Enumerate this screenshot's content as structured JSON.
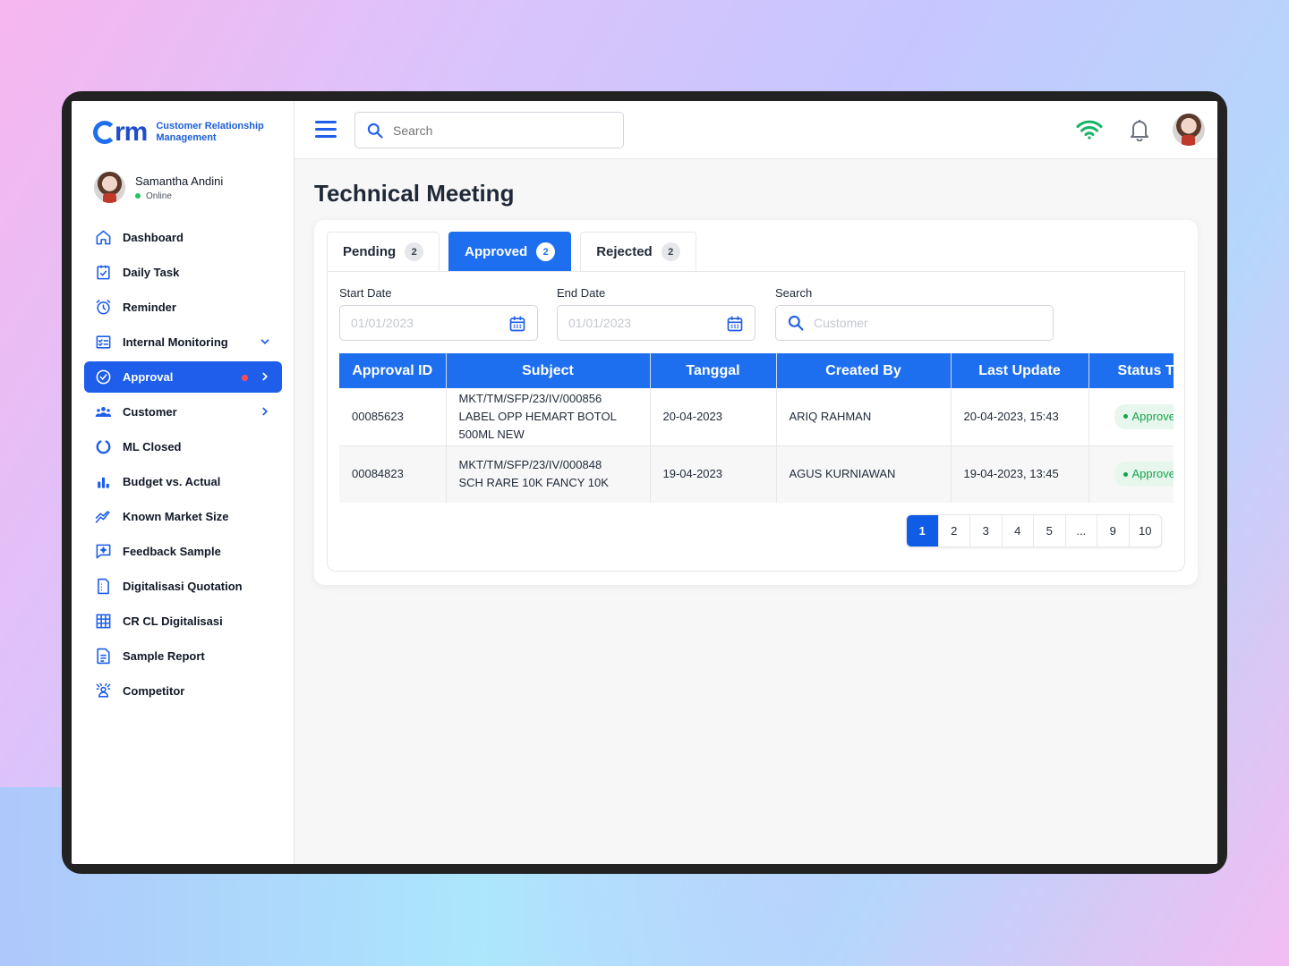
{
  "brand": {
    "logo_word": "rm",
    "tagline_line1": "Customer Relationship",
    "tagline_line2": "Management"
  },
  "user": {
    "name": "Samantha Andini",
    "status": "Online"
  },
  "sidebar": {
    "items": [
      {
        "label": "Dashboard",
        "icon": "home-icon"
      },
      {
        "label": "Daily Task",
        "icon": "clipboard-check-icon"
      },
      {
        "label": "Reminder",
        "icon": "alarm-clock-icon"
      },
      {
        "label": "Internal Monitoring",
        "icon": "checklist-icon",
        "expandable": "down"
      },
      {
        "label": "Approval",
        "icon": "check-circle-icon",
        "active": true,
        "badge": "red-dot",
        "expandable": "right"
      },
      {
        "label": "Customer",
        "icon": "users-icon",
        "expandable": "right"
      },
      {
        "label": "ML Closed",
        "icon": "ring-icon"
      },
      {
        "label": "Budget vs. Actual",
        "icon": "bar-chart-icon"
      },
      {
        "label": "Known Market Size",
        "icon": "trend-line-icon"
      },
      {
        "label": "Feedback Sample",
        "icon": "feedback-icon"
      },
      {
        "label": "Digitalisasi Quotation",
        "icon": "document-icon"
      },
      {
        "label": "CR CL Digitalisasi",
        "icon": "grid-table-icon"
      },
      {
        "label": "Sample Report",
        "icon": "report-icon"
      },
      {
        "label": "Competitor",
        "icon": "competitor-icon"
      }
    ]
  },
  "topbar": {
    "search_placeholder": "Search",
    "icons": [
      "menu-icon",
      "search-icon",
      "wifi-icon",
      "bell-icon"
    ]
  },
  "page": {
    "title": "Technical Meeting"
  },
  "tabs": [
    {
      "label": "Pending",
      "count": "2"
    },
    {
      "label": "Approved",
      "count": "2",
      "active": true
    },
    {
      "label": "Rejected",
      "count": "2"
    }
  ],
  "filters": {
    "start_label": "Start Date",
    "start_placeholder": "01/01/2023",
    "end_label": "End Date",
    "end_placeholder": "01/01/2023",
    "search_label": "Search",
    "search_placeholder": "Customer"
  },
  "table": {
    "columns": [
      "Approval ID",
      "Subject",
      "Tanggal",
      "Created By",
      "Last Update",
      "Status T"
    ],
    "rows": [
      {
        "id": "00085623",
        "subject": [
          "MKT/TM/SFP/23/IV/000856",
          "LABEL OPP HEMART BOTOL",
          "500ML NEW"
        ],
        "tanggal": "20-04-2023",
        "created_by": "ARIQ RAHMAN",
        "last_update": "20-04-2023, 15:43",
        "status": "Approved"
      },
      {
        "id": "00084823",
        "subject": [
          "MKT/TM/SFP/23/IV/000848",
          "SCH RARE 10K FANCY 10K"
        ],
        "tanggal": "19-04-2023",
        "created_by": "AGUS KURNIAWAN",
        "last_update": "19-04-2023, 13:45",
        "status": "Approved"
      }
    ]
  },
  "pagination": {
    "pages": [
      "1",
      "2",
      "3",
      "4",
      "5",
      "...",
      "9",
      "10"
    ],
    "current": "1"
  },
  "colors": {
    "primary": "#1e6ff0",
    "active_nav": "#1e5eea",
    "status_green": "#16a34a",
    "wifi_green": "#16b364",
    "alert_red": "#ff4d4f"
  }
}
